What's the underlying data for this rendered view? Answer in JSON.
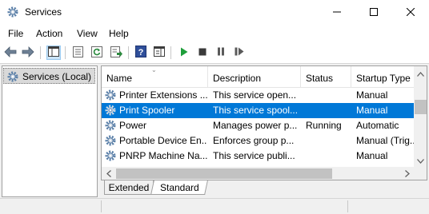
{
  "window": {
    "title": "Services",
    "app_icon": "gear-icon",
    "controls": [
      "minimize-icon",
      "maximize-icon",
      "close-icon"
    ]
  },
  "menu": {
    "items": [
      "File",
      "Action",
      "View",
      "Help"
    ]
  },
  "toolbar": {
    "buttons": [
      "back-arrow-icon",
      "forward-arrow-icon",
      "console-tree-icon",
      "properties-icon",
      "refresh-icon",
      "export-list-icon",
      "help-icon",
      "show-action-pane-icon",
      "start-service-icon",
      "stop-service-icon",
      "pause-service-icon",
      "restart-service-icon"
    ],
    "start_color": "#1e9e3a"
  },
  "tree": {
    "selected_label": "Services (Local)"
  },
  "table": {
    "columns": [
      "Name",
      "Description",
      "Status",
      "Startup Type"
    ],
    "rows": [
      {
        "name": "Printer Extensions ...",
        "description": "This service open...",
        "status": "",
        "startup": "Manual",
        "selected": false
      },
      {
        "name": "Print Spooler",
        "description": "This service spool...",
        "status": "",
        "startup": "Manual",
        "selected": true
      },
      {
        "name": "Power",
        "description": "Manages power p...",
        "status": "Running",
        "startup": "Automatic",
        "selected": false
      },
      {
        "name": "Portable Device En...",
        "description": "Enforces group p...",
        "status": "",
        "startup": "Manual (Trig...",
        "selected": false
      },
      {
        "name": "PNRP Machine Na...",
        "description": "This service publi...",
        "status": "",
        "startup": "Manual",
        "selected": false
      }
    ],
    "selection_color": "#0078d7"
  },
  "tabs": {
    "extended": "Extended",
    "standard": "Standard",
    "active": "Standard"
  }
}
